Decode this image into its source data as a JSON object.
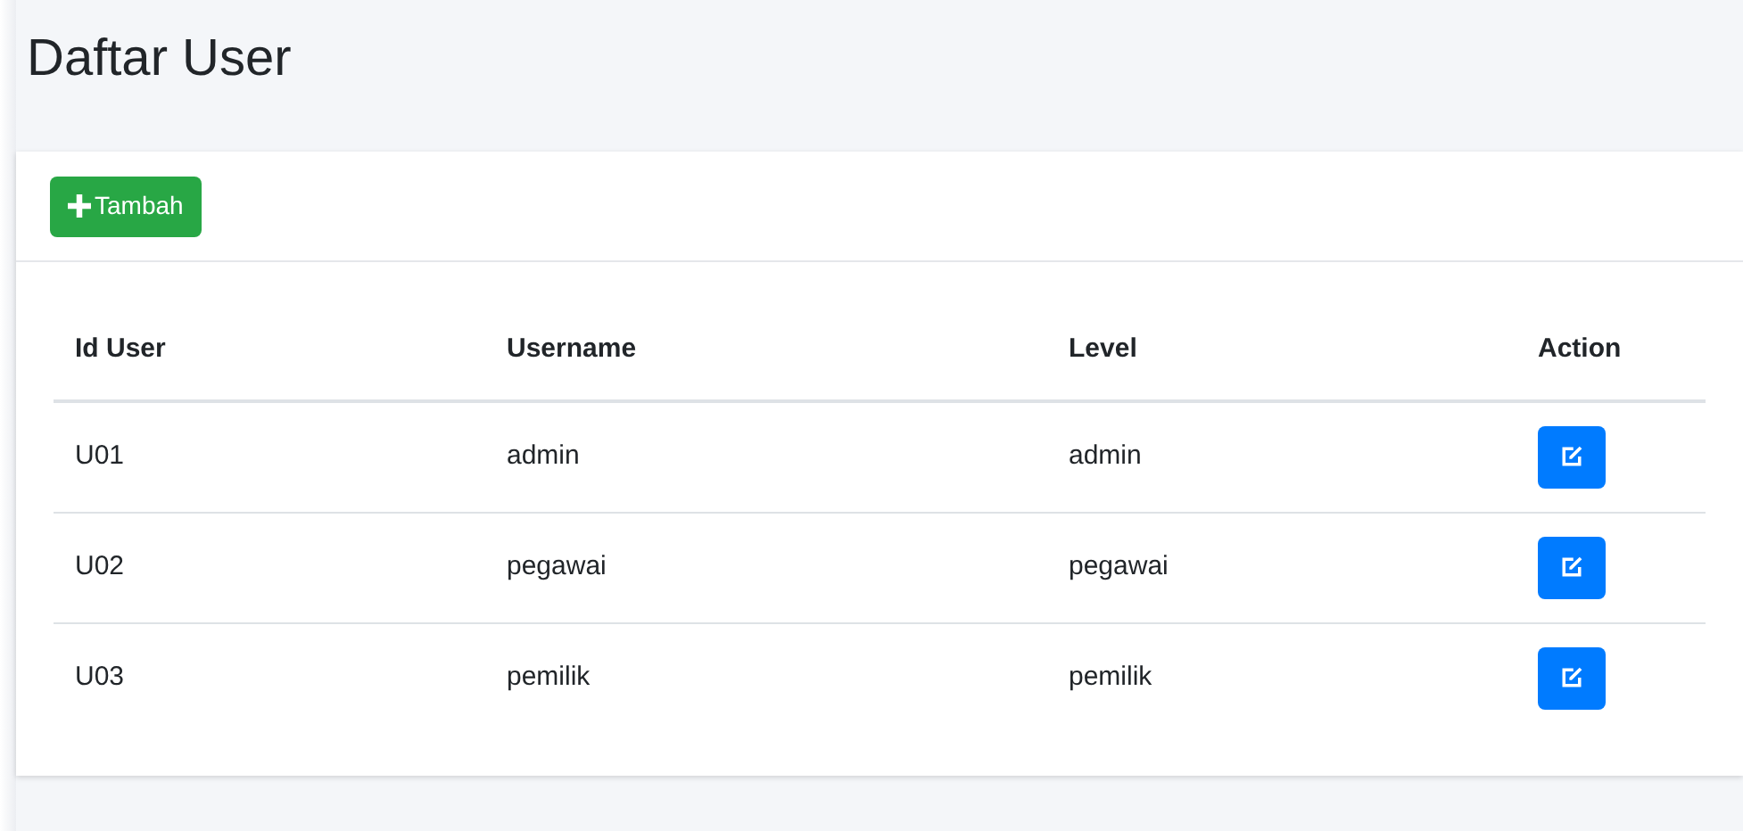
{
  "page": {
    "title": "Daftar User"
  },
  "add_button": {
    "label": "Tambah"
  },
  "table": {
    "columns": [
      "Id User",
      "Username",
      "Level",
      "Action"
    ],
    "rows": [
      {
        "id": "U01",
        "username": "admin",
        "level_name": "admin"
      },
      {
        "id": "U02",
        "username": "pegawai",
        "level_name": "pegawai"
      },
      {
        "id": "U03",
        "username": "pemilik",
        "level_name": "pemilik"
      }
    ]
  }
}
